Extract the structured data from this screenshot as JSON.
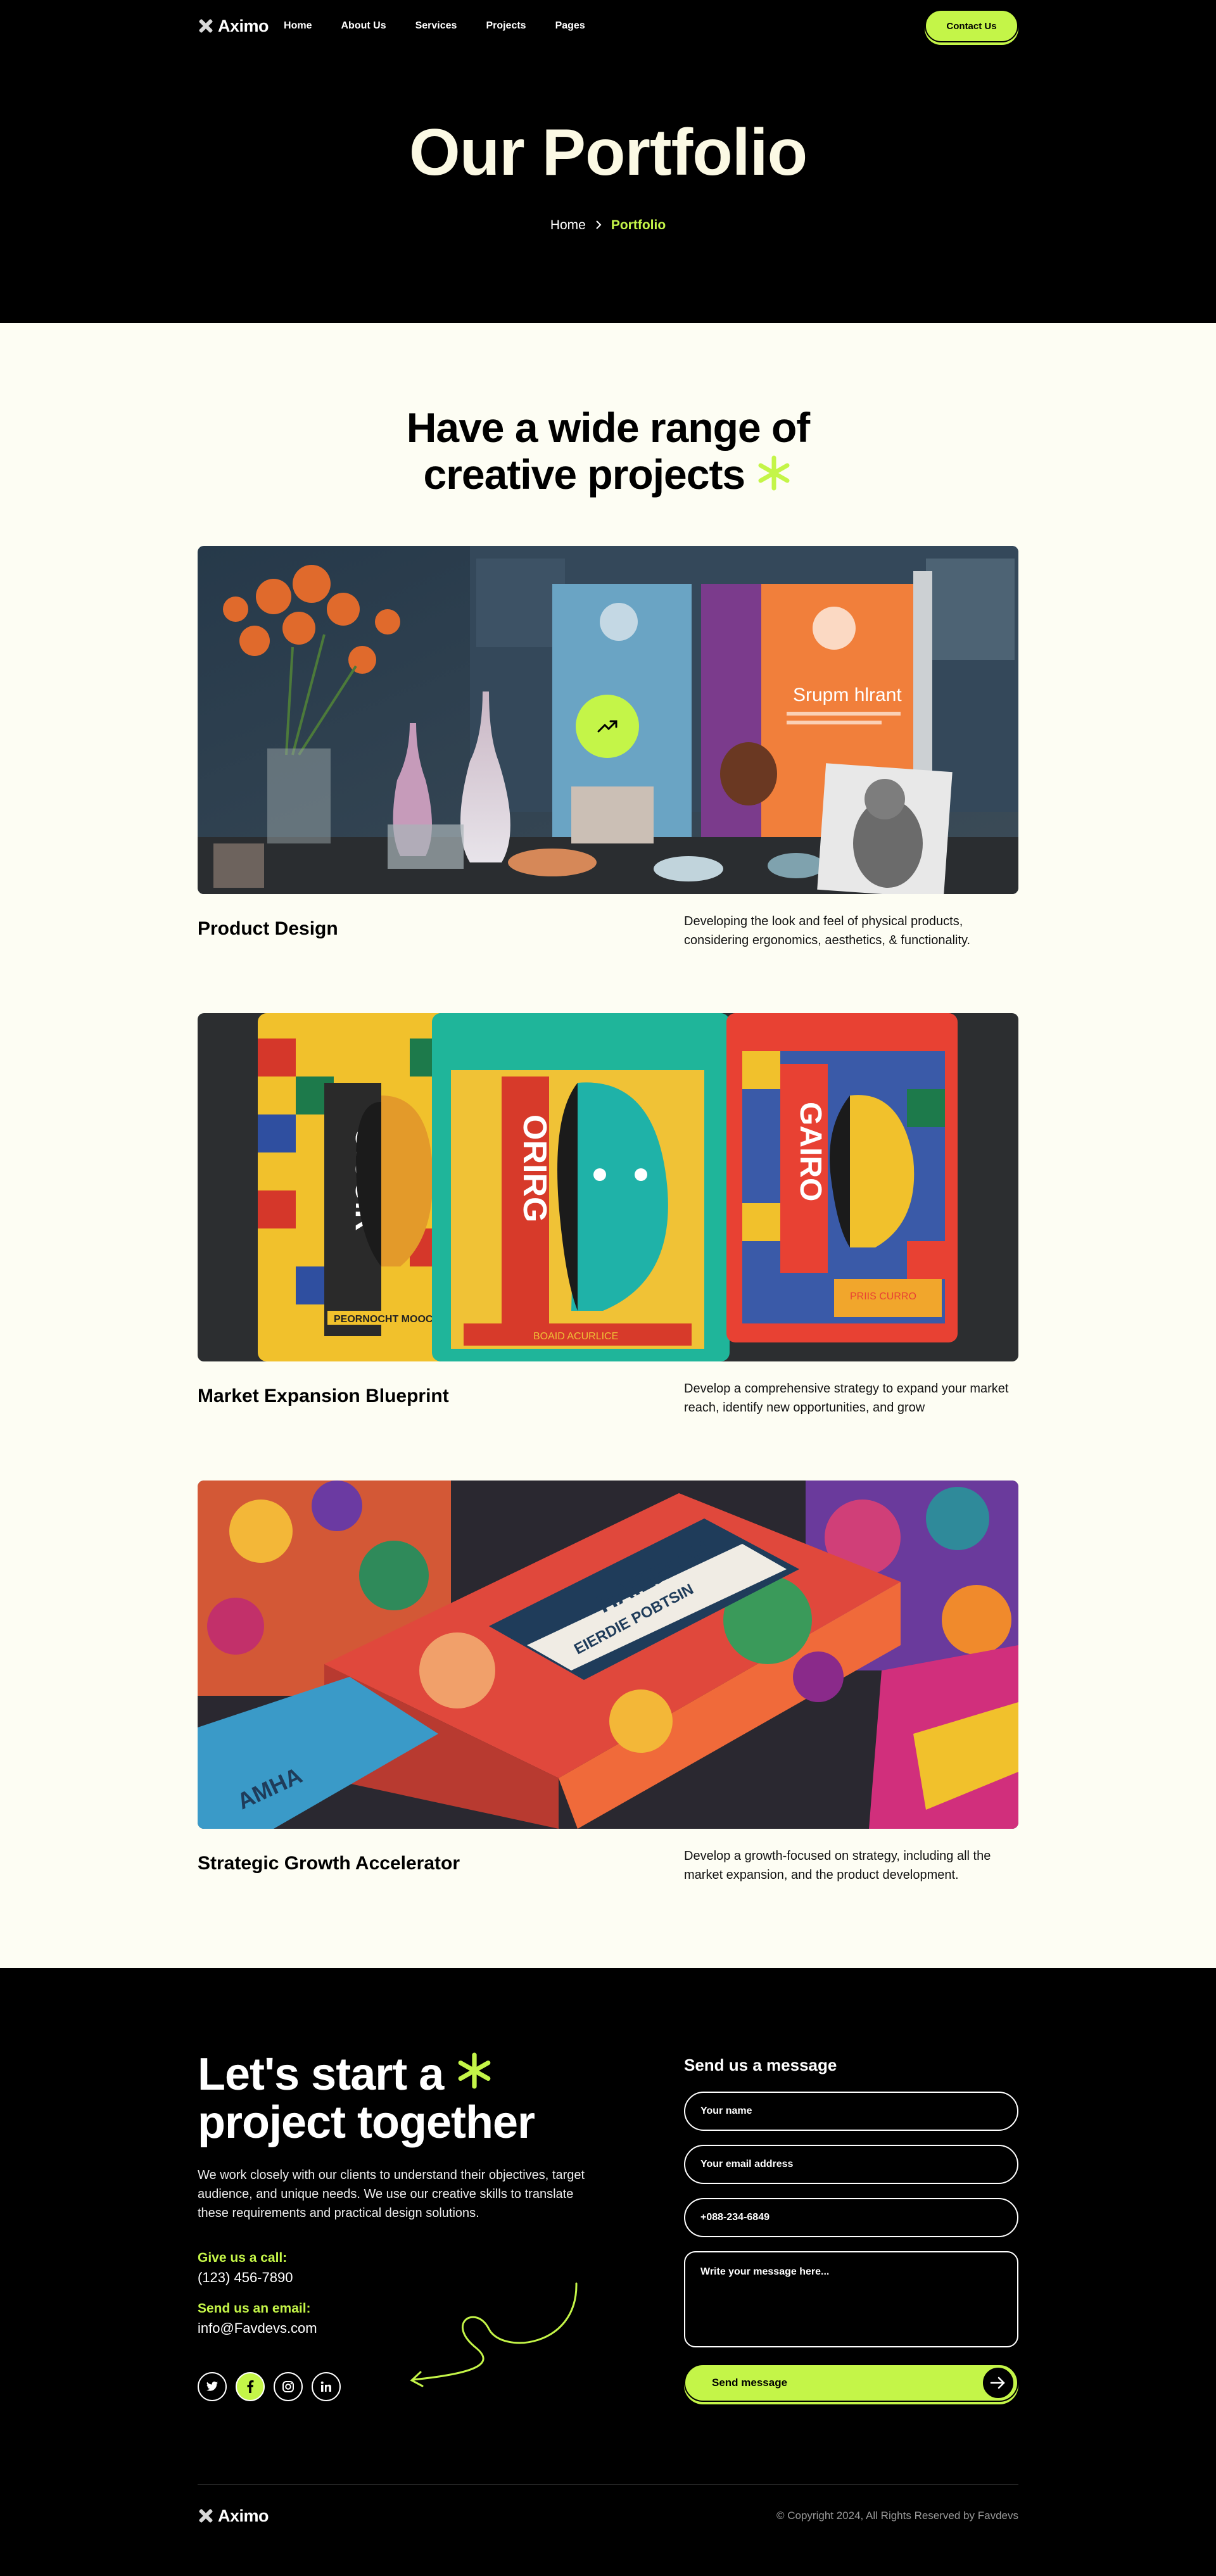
{
  "brand": {
    "name": "Aximo"
  },
  "nav": {
    "items": [
      {
        "label": "Home"
      },
      {
        "label": "About Us"
      },
      {
        "label": "Services"
      },
      {
        "label": "Projects"
      },
      {
        "label": "Pages"
      }
    ],
    "contact_label": "Contact Us"
  },
  "hero": {
    "title": "Our Portfolio",
    "breadcrumb": {
      "home": "Home",
      "current": "Portfolio"
    }
  },
  "portfolio": {
    "title_line1": "Have a wide range of",
    "title_line2": "creative projects",
    "asterisk": "✳",
    "projects": [
      {
        "title": "Product Design",
        "description": "Developing the look and feel of physical products, considering ergonomics, aesthetics, & functionality."
      },
      {
        "title": "Market Expansion Blueprint",
        "description": "Develop a comprehensive strategy to expand your market reach, identify new opportunities, and grow"
      },
      {
        "title": "Strategic Growth Accelerator",
        "description": "Develop a growth-focused on strategy, including all the market expansion, and the product development."
      }
    ]
  },
  "contact": {
    "title_line1": "Let's start a",
    "title_line2": "project together",
    "text": "We work closely with our clients to understand their objectives, target audience, and unique needs. We use our creative skills to translate these requirements and practical design solutions.",
    "call_label": "Give us a call:",
    "call_value": "(123) 456-7890",
    "email_label": "Send us an email:",
    "email_value": "info@Favdevs.com",
    "form": {
      "title": "Send us a message",
      "name_placeholder": "Your name",
      "email_placeholder": "Your email address",
      "phone_placeholder": "+088-234-6849",
      "message_placeholder": "Write your message here...",
      "submit_label": "Send message"
    }
  },
  "footer": {
    "copyright": "© Copyright 2024, All Rights Reserved by Favdevs"
  },
  "colors": {
    "accent": "#c4f548",
    "cream": "#fdfdf3",
    "dark": "#000000"
  }
}
